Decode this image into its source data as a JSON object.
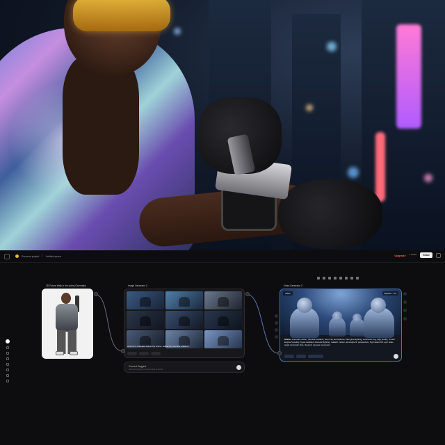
{
  "app": {
    "breadcrumb": {
      "project": "Personal project",
      "file": "Untitled space"
    },
    "upgrade_label": "Upgrade",
    "share_label": "Share",
    "right_label": "1 Public",
    "icons": [
      "menu-icon",
      "folder-icon",
      "file-icon",
      "share-icon",
      "settings-icon"
    ]
  },
  "nodes": {
    "character": {
      "title": "3D Future Walk in the skies (Cinematic)"
    },
    "image_gen": {
      "title": "Image Generator 2",
      "caption": "cinema in cinematic future city scene, soldiers in futuristic uniforms",
      "connect_label": "Connect Suggest",
      "connect_sub": "Add a text prompt to connect and generate"
    },
    "video_gen": {
      "title": "Video Generator 3",
      "chip_left": "Video",
      "chip_right": "Explore · 3:9",
      "prompt_label": "Scene:",
      "prompt_text": "cinematic action, futuristic soldiers, neon city atmosphere, blue glow lighting, volumetric fog, high quality, Unreal Engine 5 quality, hyper-detailed, dramatic lighting, realistic motion, atmospheric perspective, high detail, 8K, epic wide-angle cinematic shot, dynamic camera movement",
      "duration_label": "Duration of 5 Sec"
    }
  },
  "colors": {
    "accent_red": "#ff5b5b",
    "node_border_active": "#4a6fb0",
    "background": "#0d0d0f"
  }
}
